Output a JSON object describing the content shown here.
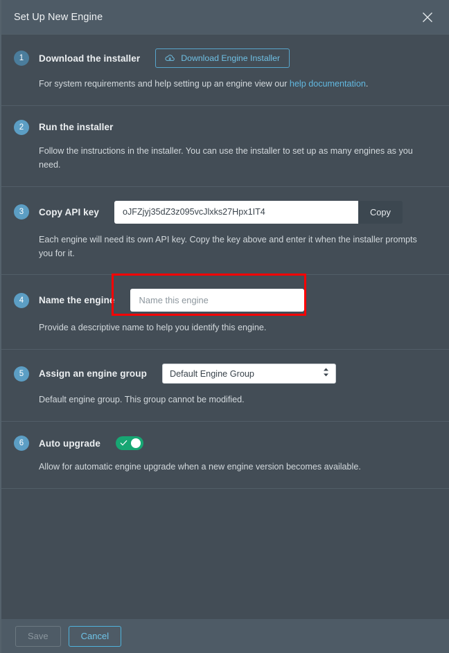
{
  "header": {
    "title": "Set Up New Engine",
    "close_icon": "close-icon"
  },
  "steps": [
    {
      "number": "1",
      "title": "Download the installer",
      "button_label": "Download Engine Installer",
      "button_icon": "cloud-download-icon",
      "desc_before": "For system requirements and help setting up an engine view our ",
      "link_text": "help documentation",
      "desc_after": "."
    },
    {
      "number": "2",
      "title": "Run the installer",
      "desc": "Follow the instructions in the installer. You can use the installer to set up as many engines as you need."
    },
    {
      "number": "3",
      "title": "Copy API key",
      "api_key": "oJFZjyj35dZ3z095vcJlxks27Hpx1IT4",
      "copy_label": "Copy",
      "desc": "Each engine will need its own API key. Copy the key above and enter it when the installer prompts you for it."
    },
    {
      "number": "4",
      "title": "Name the engine",
      "input_value": "",
      "input_placeholder": "Name this engine",
      "desc": "Provide a descriptive name to help you identify this engine."
    },
    {
      "number": "5",
      "title": "Assign an engine group",
      "selected_option": "Default Engine Group",
      "options": [
        "Default Engine Group"
      ],
      "desc": "Default engine group. This group cannot be modified."
    },
    {
      "number": "6",
      "title": "Auto upgrade",
      "toggle_state": "on",
      "toggle_icon": "check-icon",
      "desc": "Allow for automatic engine upgrade when a new engine version becomes available."
    }
  ],
  "footer": {
    "save_label": "Save",
    "cancel_label": "Cancel"
  },
  "colors": {
    "accent": "#62b8e0",
    "toggle_on": "#17a673",
    "highlight": "#fe0000",
    "panel": "#434d56",
    "bar": "#4e5b66"
  }
}
